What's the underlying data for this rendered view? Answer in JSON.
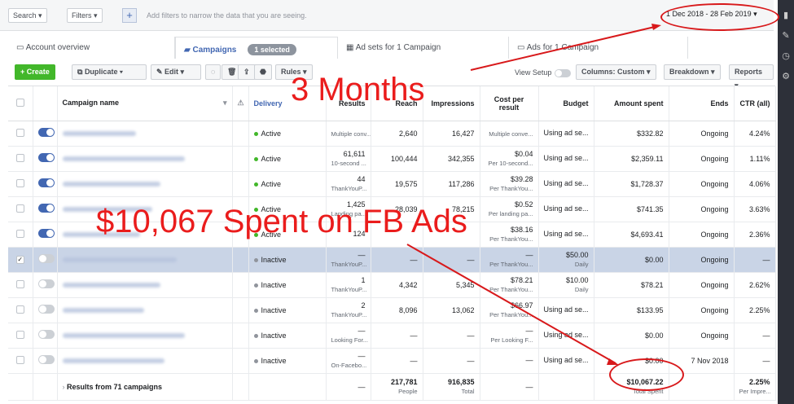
{
  "filterbar": {
    "search": "Search ▾",
    "filters": "Filters ▾",
    "hint": "Add filters to narrow the data that you are seeing.",
    "date_range": "1 Dec 2018 - 28 Feb 2019 ▾"
  },
  "tabs": {
    "account": "Account overview",
    "campaigns": "Campaigns",
    "selected": "1 selected",
    "adsets": "Ad sets for 1 Campaign",
    "ads": "Ads for 1 Campaign"
  },
  "toolbar": {
    "create": "+ Create",
    "duplicate": "Duplicate",
    "edit": "Edit",
    "rules": "Rules ▾",
    "view_setup": "View Setup",
    "columns": "Columns: Custom ▾",
    "breakdown": "Breakdown ▾",
    "reports": "Reports ▾"
  },
  "headers": {
    "name": "Campaign name",
    "delivery": "Delivery",
    "results": "Results",
    "reach": "Reach",
    "impressions": "Impressions",
    "cost": "Cost per result",
    "budget": "Budget",
    "spent": "Amount spent",
    "ends": "Ends",
    "ctr": "CTR (all)"
  },
  "rows": [
    {
      "delivery": "Active",
      "res": "",
      "res_sub": "Multiple conv...",
      "reach": "2,640",
      "impr": "16,427",
      "cost": "",
      "cost_sub": "Multiple conve...",
      "budget": "Using ad se...",
      "budget_sub": "",
      "spent": "$332.82",
      "ends": "Ongoing",
      "ctr": "4.24%"
    },
    {
      "delivery": "Active",
      "res": "61,611",
      "res_sub": "10-second ...",
      "reach": "100,444",
      "impr": "342,355",
      "cost": "$0.04",
      "cost_sub": "Per 10-second...",
      "budget": "Using ad se...",
      "budget_sub": "",
      "spent": "$2,359.11",
      "ends": "Ongoing",
      "ctr": "1.11%"
    },
    {
      "delivery": "Active",
      "res": "44",
      "res_sub": "ThankYouP...",
      "reach": "19,575",
      "impr": "117,286",
      "cost": "$39.28",
      "cost_sub": "Per ThankYou...",
      "budget": "Using ad se...",
      "budget_sub": "",
      "spent": "$1,728.37",
      "ends": "Ongoing",
      "ctr": "4.06%"
    },
    {
      "delivery": "Active",
      "res": "1,425",
      "res_sub": "Landing pa...",
      "reach": "28,039",
      "impr": "78,215",
      "cost": "$0.52",
      "cost_sub": "Per landing pa...",
      "budget": "Using ad se...",
      "budget_sub": "",
      "spent": "$741.35",
      "ends": "Ongoing",
      "ctr": "3.63%"
    },
    {
      "delivery": "Active",
      "res": "124",
      "res_sub": "",
      "reach": "",
      "impr": "",
      "cost": "$38.16",
      "cost_sub": "Per ThankYou...",
      "budget": "Using ad se...",
      "budget_sub": "",
      "spent": "$4,693.41",
      "ends": "Ongoing",
      "ctr": "2.36%"
    },
    {
      "delivery": "Inactive",
      "res": "—",
      "res_sub": "ThankYouP...",
      "reach": "—",
      "impr": "—",
      "cost": "—",
      "cost_sub": "Per ThankYou...",
      "budget": "$50.00",
      "budget_sub": "Daily",
      "spent": "$0.00",
      "ends": "Ongoing",
      "ctr": "—"
    },
    {
      "delivery": "Inactive",
      "res": "1",
      "res_sub": "ThankYouP...",
      "reach": "4,342",
      "impr": "5,345",
      "cost": "$78.21",
      "cost_sub": "Per ThankYou...",
      "budget": "$10.00",
      "budget_sub": "Daily",
      "spent": "$78.21",
      "ends": "Ongoing",
      "ctr": "2.62%"
    },
    {
      "delivery": "Inactive",
      "res": "2",
      "res_sub": "ThankYouP...",
      "reach": "8,096",
      "impr": "13,062",
      "cost": "$66.97",
      "cost_sub": "Per ThankYou...",
      "budget": "Using ad se...",
      "budget_sub": "",
      "spent": "$133.95",
      "ends": "Ongoing",
      "ctr": "2.25%"
    },
    {
      "delivery": "Inactive",
      "res": "—",
      "res_sub": "Looking For...",
      "reach": "—",
      "impr": "—",
      "cost": "—",
      "cost_sub": "Per Looking F...",
      "budget": "Using ad se...",
      "budget_sub": "",
      "spent": "$0.00",
      "ends": "Ongoing",
      "ctr": "—"
    },
    {
      "delivery": "Inactive",
      "res": "—",
      "res_sub": "On-Facebo...",
      "reach": "—",
      "impr": "—",
      "cost": "—",
      "cost_sub": "",
      "budget": "Using ad se...",
      "budget_sub": "",
      "spent": "$0.00",
      "ends": "7 Nov 2018",
      "ctr": "—"
    }
  ],
  "summary": {
    "label": "Results from 71 campaigns",
    "res": "—",
    "reach": "217,781",
    "reach_sub": "People",
    "impr": "916,835",
    "impr_sub": "Total",
    "cost": "—",
    "spent": "$10,067.22",
    "spent_sub": "Total Spent",
    "ctr": "2.25%",
    "ctr_sub": "Per Impre..."
  },
  "annotations": {
    "months": "3 Months",
    "spent": "$10,067 Spent on FB Ads",
    "color": "#ea1c1c"
  }
}
